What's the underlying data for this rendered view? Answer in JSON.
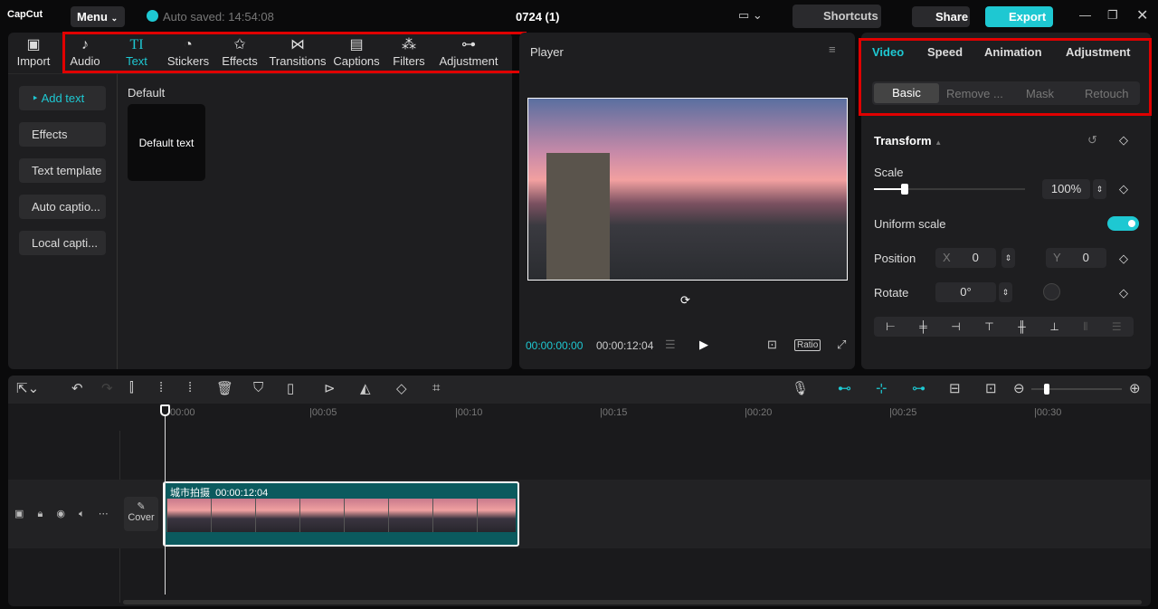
{
  "app": {
    "logo": "CapCut",
    "menu": "Menu",
    "autosave": "Auto saved: 14:54:08",
    "project_title": "0724 (1)",
    "shortcuts": "Shortcuts",
    "share": "Share",
    "export": "Export"
  },
  "toolbar": [
    {
      "label": "Import",
      "icon": "▣"
    },
    {
      "label": "Audio",
      "icon": "♪"
    },
    {
      "label": "Text",
      "icon": "TI"
    },
    {
      "label": "Stickers",
      "icon": "◔"
    },
    {
      "label": "Effects",
      "icon": "✩"
    },
    {
      "label": "Transitions",
      "icon": "⋈"
    },
    {
      "label": "Captions",
      "icon": "▤"
    },
    {
      "label": "Filters",
      "icon": "⁂"
    },
    {
      "label": "Adjustment",
      "icon": "⊶"
    }
  ],
  "left_nav": [
    "Add text",
    "Effects",
    "Text template",
    "Auto captio...",
    "Local capti..."
  ],
  "text_panel": {
    "section": "Default",
    "card": "Default text"
  },
  "player": {
    "title": "Player",
    "current_time": "00:00:00:00",
    "total_time": "00:00:12:04",
    "ratio": "Ratio"
  },
  "inspector": {
    "tabs": [
      "Video",
      "Speed",
      "Animation",
      "Adjustment"
    ],
    "subtabs": [
      "Basic",
      "Remove ...",
      "Mask",
      "Retouch"
    ],
    "section": "Transform",
    "scale_label": "Scale",
    "scale_value": "100%",
    "scale_percent": 100,
    "uniform_scale": "Uniform scale",
    "uniform_on": true,
    "position_label": "Position",
    "x_label": "X",
    "x_value": "0",
    "y_label": "Y",
    "y_value": "0",
    "rotate_label": "Rotate",
    "rotate_value": "0°"
  },
  "timeline": {
    "ticks": [
      "00:00",
      "|00:05",
      "|00:10",
      "|00:15",
      "|00:20",
      "|00:25",
      "|00:30"
    ],
    "clip_name": "城市拍摄",
    "clip_duration": "00:00:12:04",
    "cover": "Cover"
  },
  "colors": {
    "accent": "#1ec8d2",
    "highlight": "#e00000",
    "clip": "#0b5a5e"
  }
}
